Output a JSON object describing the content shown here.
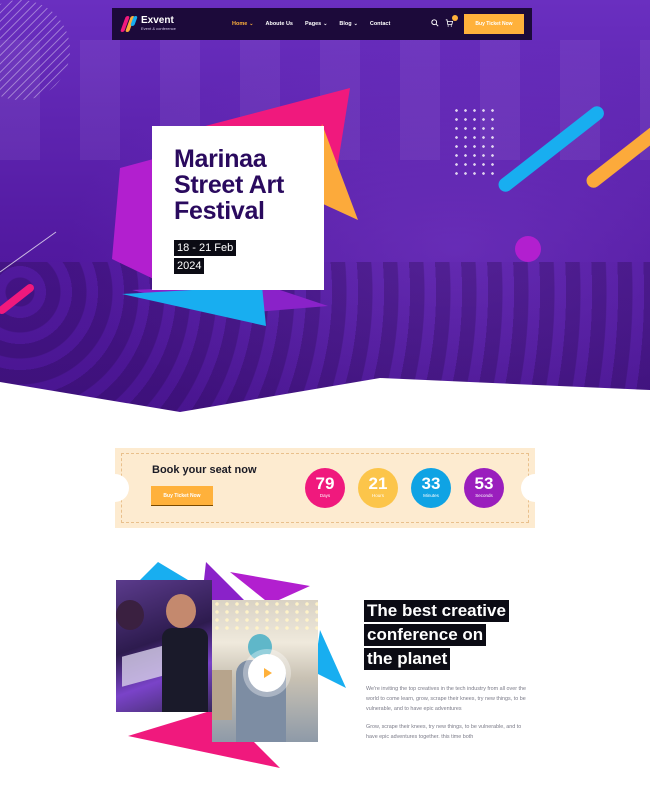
{
  "nav": {
    "brand_name": "Exvent",
    "brand_tagline": "Event & conference",
    "menu": [
      {
        "label": "Home",
        "has_dropdown": true,
        "active": true
      },
      {
        "label": "Aboute Us",
        "has_dropdown": false,
        "active": false
      },
      {
        "label": "Pages",
        "has_dropdown": true,
        "active": false
      },
      {
        "label": "Blog",
        "has_dropdown": true,
        "active": false
      },
      {
        "label": "Contact",
        "has_dropdown": false,
        "active": false
      }
    ],
    "icons": [
      "search-icon",
      "cart-icon"
    ],
    "cta_label": "Buy Ticket Now"
  },
  "hero": {
    "title_lines": [
      "Marinaa",
      "Street Art",
      "Festival"
    ],
    "date_lines": [
      "18 - 21 Feb",
      "2024"
    ]
  },
  "countdown": {
    "title": "Book your seat now",
    "button_label": "Buy Ticket Now",
    "items": [
      {
        "value": "79",
        "label": "Days",
        "color": "#f0197d"
      },
      {
        "value": "21",
        "label": "Hours",
        "color": "#fcc54a"
      },
      {
        "value": "33",
        "label": "Minutes",
        "color": "#0fa3e4"
      },
      {
        "value": "53",
        "label": "Seconds",
        "color": "#9a1ebd"
      }
    ]
  },
  "feature": {
    "headline_lines": [
      "The best creative",
      "conference on",
      "the planet"
    ],
    "paragraphs": [
      "We're inviting the top creatives in the tech industry from all over the world to come learn, grow, scrape their knees, try new things, to be vulnerable, and to have epic adventures",
      "Grow, scrape their knees, try new things, to be vulnerable, and to have epic adventures together. this time both"
    ]
  },
  "colors": {
    "purple": "#5a1ea6",
    "pink": "#f0197d",
    "yellow": "#fcaa3b",
    "blue": "#18aef0",
    "magenta": "#b21fcf",
    "navy": "#1c0a3a"
  }
}
